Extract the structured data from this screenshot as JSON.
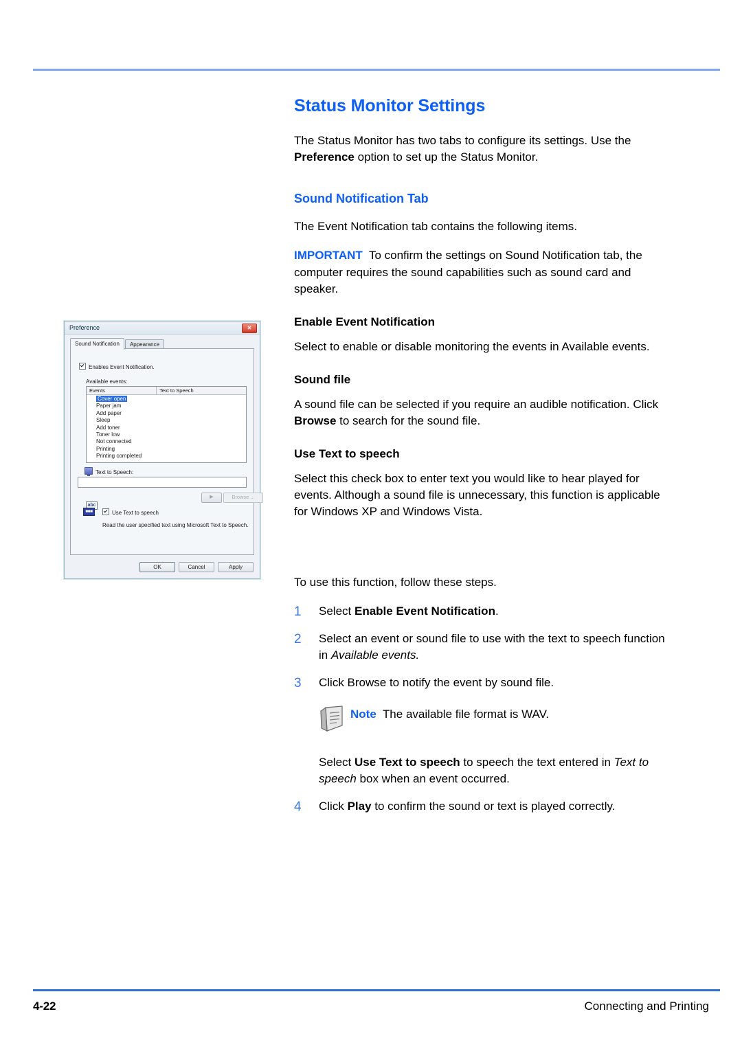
{
  "doc": {
    "title": "Status Monitor Settings",
    "intro_1": "The Status Monitor has two tabs to configure its settings. Use the ",
    "intro_bold": "Preference",
    "intro_2": " option to set up the Status Monitor.",
    "section_title": "Sound Notification Tab",
    "section_intro": "The Event Notification tab contains the following items.",
    "important_kw": "IMPORTANT",
    "important_text": "To confirm the settings on Sound Notification tab, the computer requires the sound capabilities such as sound card and speaker.",
    "sub1_title": "Enable Event Notification",
    "sub1_body": "Select to enable or disable monitoring the events in Available events.",
    "sub2_title": "Sound file",
    "sub2_body_1": "A sound file can be selected if you require an audible notification. Click ",
    "sub2_body_bold": "Browse",
    "sub2_body_2": " to search for the sound file.",
    "sub3_title": "Use Text to speech",
    "sub3_body": "Select this check box to enter text you would like to hear played for events. Although a sound file is unnecessary, this function is applicable for Windows XP and Windows Vista.",
    "steps_intro": "To use this function, follow these steps.",
    "steps": [
      {
        "num": "1",
        "pre": "Select ",
        "bold": "Enable Event Notification",
        "post": "."
      },
      {
        "num": "2",
        "pre": "Select an event or sound file to use with the text to speech function in ",
        "italic": "Available events.",
        "post": ""
      },
      {
        "num": "3",
        "pre": "Click Browse to notify the event by sound file.",
        "bold": "",
        "post": ""
      },
      {
        "num": "4",
        "pre": "Click ",
        "bold": "Play",
        "post": " to confirm the sound or text is played correctly."
      }
    ],
    "note_kw": "Note",
    "note_text": "The available file format is WAV.",
    "after_note_1": "Select ",
    "after_note_bold": "Use Text to speech",
    "after_note_2": " to speech the text entered in ",
    "after_note_italic": "Text to speech",
    "after_note_3": " box when an event occurred."
  },
  "footer": {
    "page_number": "4-22",
    "chapter": "Connecting and Printing"
  },
  "colors": {
    "heading_blue": "#0d5ff5",
    "step_number_blue": "#3d7ae8",
    "header_rule": "#7aa9ee",
    "footer_rule": "#2f6fd0",
    "selection_blue": "#2a6ede"
  },
  "dialog": {
    "title": "Preference",
    "close_label": "✕",
    "tabs": [
      {
        "label": "Sound Notification",
        "active": true
      },
      {
        "label": "Appearance",
        "active": false
      }
    ],
    "enable_checkbox_label": "Enables Event Notification.",
    "available_events_label": "Available events:",
    "list_headers": [
      "Events",
      "Text to Speech"
    ],
    "events": [
      {
        "name": "Cover open",
        "selected": true
      },
      {
        "name": "Paper jam",
        "selected": false
      },
      {
        "name": "Add paper",
        "selected": false
      },
      {
        "name": "Sleep",
        "selected": false
      },
      {
        "name": "Add toner",
        "selected": false
      },
      {
        "name": "Toner low",
        "selected": false
      },
      {
        "name": "Not connected",
        "selected": false
      },
      {
        "name": "Printing",
        "selected": false
      },
      {
        "name": "Printing completed",
        "selected": false
      }
    ],
    "tts_label": "Text to Speech:",
    "tts_value": "",
    "play_label": "▶",
    "browse_label": "Browse ...",
    "use_tts_label": "Use Text to speech",
    "tts_description": "Read the user specified text using Microsoft Text to Speech.",
    "buttons": [
      {
        "label": "OK",
        "default": true
      },
      {
        "label": "Cancel",
        "default": false
      },
      {
        "label": "Apply",
        "default": false
      }
    ],
    "abc_icon_top": "abc",
    "abc_icon_bottom": "■■■"
  }
}
